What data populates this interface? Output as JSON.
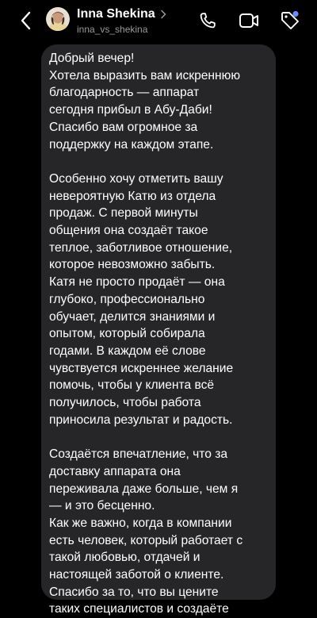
{
  "header": {
    "contact_name": "Inna Shekina",
    "contact_handle": "inna_vs_shekina",
    "icons": {
      "back": "chevron-left-icon",
      "name_chevron": "chevron-right-icon",
      "phone": "phone-icon",
      "video": "video-camera-icon",
      "tag": "tag-icon"
    },
    "colors": {
      "background": "#000000",
      "bubble": "#262629",
      "handle_text": "#9a9a9e",
      "badge": "#6b8cff"
    }
  },
  "message": {
    "paragraphs": [
      [
        "Добрый вечер!",
        "Хотела выразить вам искреннюю",
        "благодарность — аппарат",
        "сегодня прибыл в Абу-Даби!",
        "Спасибо вам огромное за",
        "поддержку на каждом этапе."
      ],
      [
        "Особенно хочу отметить вашу",
        "невероятную Катю из отдела",
        "продаж. С первой минуты",
        "общения она создаёт такое",
        "теплое, заботливое отношение,",
        "которое невозможно забыть.",
        "Катя не просто продаёт — она",
        "глубоко, профессионально",
        "обучает, делится знаниями и",
        "опытом, который собирала",
        "годами. В каждом её слове",
        "чувствуется искреннее желание",
        "помочь, чтобы у клиента всё",
        "получилось, чтобы работа",
        "приносила результат и радость."
      ],
      [
        "Создаётся впечатление, что за",
        "доставку аппарата она",
        "переживала даже больше, чем я",
        "— и это бесценно.",
        "Как же важно, когда в компании",
        "есть человек, который работает с",
        "такой любовью, отдачей и",
        "настоящей заботой о клиенте.",
        "Спасибо за то, что вы цените",
        "таких специалистов и создаёте"
      ]
    ]
  }
}
